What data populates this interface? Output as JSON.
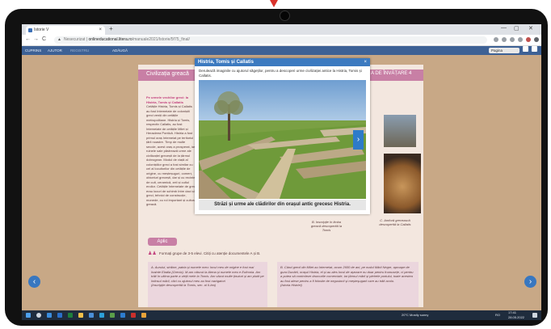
{
  "browser": {
    "tab_title": "Istorie V",
    "tab_close": "×",
    "new_tab": "+",
    "win_min": "—",
    "win_max": "▢",
    "win_close": "✕",
    "back": "←",
    "forward": "→",
    "reload": "C",
    "url_prefix": "Nesecurizat | ",
    "url_domain": "onlineducational.litera.ro",
    "url_path": "/manuale2021/Istorie/5f75_final/"
  },
  "app_toolbar": {
    "cuprins": "CUPRINS",
    "ajutor": "AJUTOR",
    "item3": "REGISTRU",
    "search": "ADĂUGĂ",
    "page_field": "Pagina",
    "colors": {
      "bar": "#3d6195"
    }
  },
  "page": {
    "title_left": "Civilizația greacă",
    "title_right": "A DE ÎNVĂȚARE 4",
    "text_lead": "Pe urmele vechilor greci: la Histria, Tomis și Callatis",
    "text_body": "Cetățile Histria, Tomis și Callatis au fost întemeiate de coloniștii greci veniți din cetățile metropolitane. Histria și Tomis, respectiv Callatis, au fost întemeiate de cetățile Milet și Heracleea Pontică. Histria a fost primul oraș întemeiat pe teritoriul țării noastre. Timp de multe secole, acest oraș a prosperat, iar ruinele sale păstrează urme ale civilizației grecești de la țărmul dobrogean. Modul de viață al coloniștilor greci a fost similar cu cel al locuitorilor din cetățile de origine, cu meșteșuguri, comerț, obiceiuri grecești, dar și cu recinte de cult, ceramică, zeii și cultul eroilor. Cetățile întemeiate de greci erau locuri de schimb între daci și greci, tehnici de construcție, monede, cu rol important și cultura greacă.",
    "caption_b": "B. Inscripție în limba greacă descoperită la Tomis",
    "caption_c": "C. Amforă grecească descoperită la Callatis",
    "aplic": "Aplic",
    "task": "Formați grupe de 3-5 elevi. Citiți cu atenție documentele A și B.",
    "doc_a": "A. Aurului, străine, patria și numele meu: locul meu de origine e fost mai înainte Eladia (Grecia). M-am născut la Atena și numele meu e Eufronia. Am trăit în ultima parte a vieții mele la Tomis. Am văzut multe ținuturi și am plutit pe întinsul mării, căci cu ajutorul meu au fost navigatori",
    "doc_a_source": "(Inscripție descoperită la Tomis, sec. al II-lea)",
    "doc_b": "B. Când grecii din Milet au întemeiat, acum 2600 de ani, pe malul Mării Negre, aproape de gura Dunării, orașul Histria, el și au ales locul de așezare nu doar pentru frumusețe, ci pentru a putea să controleze drumurile comerciale, iar țărmul mării și pietrele portului, toate acestea au fost alese pentru a fi folosite de negustorii și meșteșugarii care au trăit acolo.",
    "doc_b_source": "(Istoria Histriei)"
  },
  "modal": {
    "title": "Histria, Tomis și Callatis",
    "close": "×",
    "description": "Derulează imaginile cu ajutorul săgeților, pentru a descoperi urme civilizației antice la Histria, Tomis și Callatis.",
    "next": "›",
    "caption": "Străzi și urme ale clădirilor din orașul antic grecesc Histria."
  },
  "nav": {
    "prev": "‹",
    "next": "›"
  },
  "taskbar": {
    "weather": "20°C  Mostly sunny",
    "lang": "RO",
    "time": "17:41",
    "date": "28.05.2022"
  }
}
